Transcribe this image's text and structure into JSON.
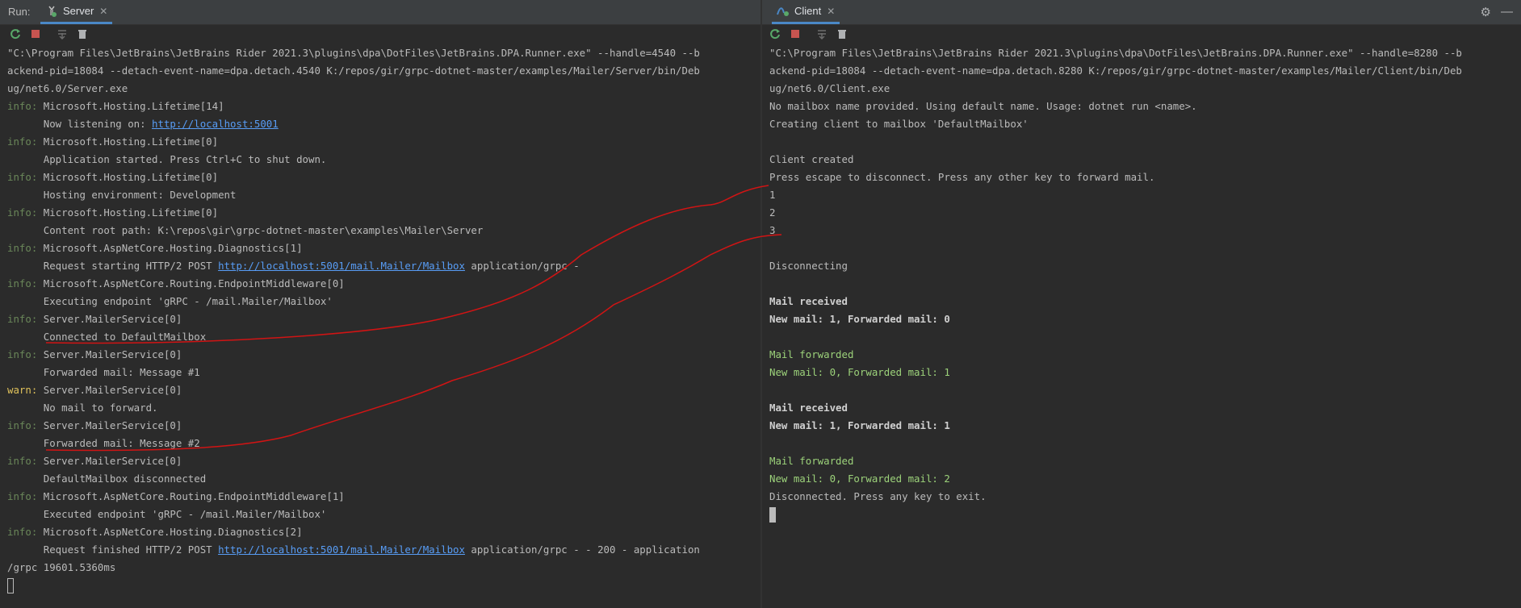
{
  "server": {
    "run_label": "Run:",
    "tab_label": "Server",
    "lines": [
      {
        "type": "plain",
        "text": "\"C:\\Program Files\\JetBrains\\JetBrains Rider 2021.3\\plugins\\dpa\\DotFiles\\JetBrains.DPA.Runner.exe\" --handle=4540 --b"
      },
      {
        "type": "plain",
        "text": "ackend-pid=18084 --detach-event-name=dpa.detach.4540 K:/repos/gir/grpc-dotnet-master/examples/Mailer/Server/bin/Deb"
      },
      {
        "type": "plain",
        "text": "ug/net6.0/Server.exe"
      },
      {
        "type": "level",
        "level": "info:",
        "text": " Microsoft.Hosting.Lifetime[14]"
      },
      {
        "type": "link",
        "pre": "      Now listening on: ",
        "link": "http://localhost:5001",
        "post": ""
      },
      {
        "type": "level",
        "level": "info:",
        "text": " Microsoft.Hosting.Lifetime[0]"
      },
      {
        "type": "plain",
        "text": "      Application started. Press Ctrl+C to shut down."
      },
      {
        "type": "level",
        "level": "info:",
        "text": " Microsoft.Hosting.Lifetime[0]"
      },
      {
        "type": "plain",
        "text": "      Hosting environment: Development"
      },
      {
        "type": "level",
        "level": "info:",
        "text": " Microsoft.Hosting.Lifetime[0]"
      },
      {
        "type": "plain",
        "text": "      Content root path: K:\\repos\\gir\\grpc-dotnet-master\\examples\\Mailer\\Server"
      },
      {
        "type": "level",
        "level": "info:",
        "text": " Microsoft.AspNetCore.Hosting.Diagnostics[1]"
      },
      {
        "type": "link",
        "pre": "      Request starting HTTP/2 POST ",
        "link": "http://localhost:5001/mail.Mailer/Mailbox",
        "post": " application/grpc -"
      },
      {
        "type": "level",
        "level": "info:",
        "text": " Microsoft.AspNetCore.Routing.EndpointMiddleware[0]"
      },
      {
        "type": "plain",
        "text": "      Executing endpoint 'gRPC - /mail.Mailer/Mailbox'"
      },
      {
        "type": "level",
        "level": "info:",
        "text": " Server.MailerService[0]"
      },
      {
        "type": "plain",
        "text": "      Connected to DefaultMailbox"
      },
      {
        "type": "level",
        "level": "info:",
        "text": " Server.MailerService[0]"
      },
      {
        "type": "plain",
        "text": "      Forwarded mail: Message #1"
      },
      {
        "type": "level",
        "level": "warn:",
        "text": " Server.MailerService[0]"
      },
      {
        "type": "plain",
        "text": "      No mail to forward."
      },
      {
        "type": "level",
        "level": "info:",
        "text": " Server.MailerService[0]"
      },
      {
        "type": "plain",
        "text": "      Forwarded mail: Message #2"
      },
      {
        "type": "level",
        "level": "info:",
        "text": " Server.MailerService[0]"
      },
      {
        "type": "plain",
        "text": "      DefaultMailbox disconnected"
      },
      {
        "type": "level",
        "level": "info:",
        "text": " Microsoft.AspNetCore.Routing.EndpointMiddleware[1]"
      },
      {
        "type": "plain",
        "text": "      Executed endpoint 'gRPC - /mail.Mailer/Mailbox'"
      },
      {
        "type": "level",
        "level": "info:",
        "text": " Microsoft.AspNetCore.Hosting.Diagnostics[2]"
      },
      {
        "type": "link",
        "pre": "      Request finished HTTP/2 POST ",
        "link": "http://localhost:5001/mail.Mailer/Mailbox",
        "post": " application/grpc - - 200 - application"
      },
      {
        "type": "plain",
        "text": "/grpc 19601.5360ms"
      },
      {
        "type": "cursor"
      }
    ]
  },
  "client": {
    "tab_label": "Client",
    "lines": [
      {
        "type": "plain",
        "text": "\"C:\\Program Files\\JetBrains\\JetBrains Rider 2021.3\\plugins\\dpa\\DotFiles\\JetBrains.DPA.Runner.exe\" --handle=8280 --b"
      },
      {
        "type": "plain",
        "text": "ackend-pid=18084 --detach-event-name=dpa.detach.8280 K:/repos/gir/grpc-dotnet-master/examples/Mailer/Client/bin/Deb"
      },
      {
        "type": "plain",
        "text": "ug/net6.0/Client.exe"
      },
      {
        "type": "plain",
        "text": "No mailbox name provided. Using default name. Usage: dotnet run <name>."
      },
      {
        "type": "plain",
        "text": "Creating client to mailbox 'DefaultMailbox'"
      },
      {
        "type": "plain",
        "text": ""
      },
      {
        "type": "plain",
        "text": "Client created"
      },
      {
        "type": "plain",
        "text": "Press escape to disconnect. Press any other key to forward mail."
      },
      {
        "type": "plain",
        "text": "1"
      },
      {
        "type": "plain",
        "text": "2"
      },
      {
        "type": "plain",
        "text": "3"
      },
      {
        "type": "plain",
        "text": ""
      },
      {
        "type": "plain",
        "text": "Disconnecting"
      },
      {
        "type": "plain",
        "text": ""
      },
      {
        "type": "bold",
        "text": "Mail received"
      },
      {
        "type": "bold",
        "text": "New mail: 1, Forwarded mail: 0"
      },
      {
        "type": "plain",
        "text": ""
      },
      {
        "type": "green",
        "text": "Mail forwarded"
      },
      {
        "type": "green",
        "text": "New mail: 0, Forwarded mail: 1"
      },
      {
        "type": "plain",
        "text": ""
      },
      {
        "type": "bold",
        "text": "Mail received"
      },
      {
        "type": "bold",
        "text": "New mail: 1, Forwarded mail: 1"
      },
      {
        "type": "plain",
        "text": ""
      },
      {
        "type": "green",
        "text": "Mail forwarded"
      },
      {
        "type": "green",
        "text": "New mail: 0, Forwarded mail: 2"
      },
      {
        "type": "plain",
        "text": "Disconnected. Press any key to exit."
      },
      {
        "type": "cursor_filled"
      }
    ]
  },
  "colors": {
    "background": "#2b2b2b",
    "info": "#6a8759",
    "warn": "#e0c25b",
    "link": "#589df6",
    "annotation": "#d11414"
  },
  "icons": {
    "server_tab": "server-run-icon",
    "client_tab": "client-run-icon",
    "rerun": "rerun-icon",
    "stop": "stop-icon",
    "scroll_end": "scroll-to-end-icon",
    "clear": "trash-icon",
    "settings": "gear-icon",
    "minimize": "minimize-icon"
  }
}
